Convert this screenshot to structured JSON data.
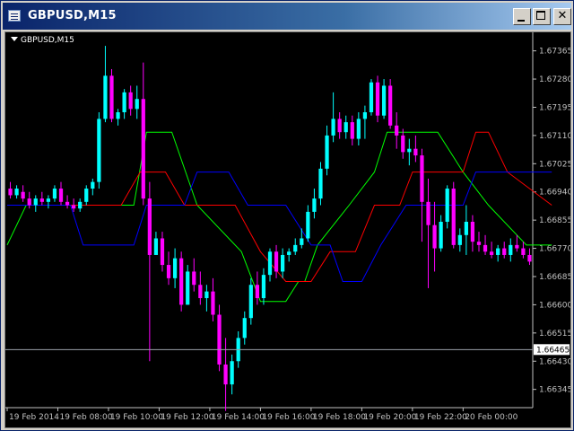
{
  "window": {
    "title": "GBPUSD,M15",
    "buttons": {
      "minimize": "minimize",
      "maximize": "maximize",
      "close": "✕"
    }
  },
  "chart": {
    "symbol_label": "GBPUSD,M15",
    "background": "#000000",
    "bull_color": "#00ffff",
    "bear_color": "#ff00ff",
    "current_price": "1.66465"
  },
  "chart_data": {
    "type": "candlestick",
    "title": "GBPUSD,M15",
    "y_ticks": [
      "1.67365",
      "1.67280",
      "1.67195",
      "1.67110",
      "1.67025",
      "1.66940",
      "1.66855",
      "1.66770",
      "1.66685",
      "1.66600",
      "1.66515",
      "1.66430",
      "1.66345"
    ],
    "ylim": [
      1.6629,
      1.6741
    ],
    "x_ticks": [
      "19 Feb 2014",
      "19 Feb 08:00",
      "19 Feb 10:00",
      "19 Feb 12:00",
      "19 Feb 14:00",
      "19 Feb 16:00",
      "19 Feb 18:00",
      "19 Feb 20:00",
      "19 Feb 22:00",
      "20 Feb 00:00"
    ],
    "current_price_line": 1.66465,
    "candles": [
      [
        1.6695,
        1.6697,
        1.6692,
        1.6693
      ],
      [
        1.6693,
        1.6696,
        1.6692,
        1.6695
      ],
      [
        1.6694,
        1.6696,
        1.6691,
        1.6692
      ],
      [
        1.6692,
        1.6694,
        1.6689,
        1.669
      ],
      [
        1.669,
        1.6693,
        1.6688,
        1.6692
      ],
      [
        1.6692,
        1.6694,
        1.669,
        1.6691
      ],
      [
        1.6691,
        1.6693,
        1.6689,
        1.6692
      ],
      [
        1.6692,
        1.6696,
        1.6691,
        1.6695
      ],
      [
        1.6695,
        1.6697,
        1.669,
        1.6691
      ],
      [
        1.6691,
        1.6693,
        1.6689,
        1.669
      ],
      [
        1.669,
        1.6692,
        1.6688,
        1.6689
      ],
      [
        1.6689,
        1.6692,
        1.6688,
        1.6691
      ],
      [
        1.6691,
        1.6696,
        1.669,
        1.6695
      ],
      [
        1.6695,
        1.6698,
        1.6693,
        1.6697
      ],
      [
        1.6697,
        1.6718,
        1.6695,
        1.6716
      ],
      [
        1.6716,
        1.6738,
        1.6715,
        1.6729
      ],
      [
        1.6729,
        1.6731,
        1.6715,
        1.6716
      ],
      [
        1.6716,
        1.6719,
        1.6714,
        1.6718
      ],
      [
        1.6718,
        1.6725,
        1.6716,
        1.6724
      ],
      [
        1.6724,
        1.6726,
        1.6717,
        1.6719
      ],
      [
        1.6719,
        1.6726,
        1.6716,
        1.6722
      ],
      [
        1.6722,
        1.6733,
        1.669,
        1.6692
      ],
      [
        1.6692,
        1.6697,
        1.6643,
        1.6675
      ],
      [
        1.6675,
        1.6682,
        1.6676,
        1.668
      ],
      [
        1.668,
        1.6682,
        1.667,
        1.6672
      ],
      [
        1.6672,
        1.6676,
        1.6666,
        1.6668
      ],
      [
        1.6668,
        1.6677,
        1.6665,
        1.6674
      ],
      [
        1.6674,
        1.6676,
        1.6658,
        1.666
      ],
      [
        1.666,
        1.6672,
        1.666,
        1.667
      ],
      [
        1.667,
        1.6674,
        1.6664,
        1.6666
      ],
      [
        1.6666,
        1.667,
        1.666,
        1.6662
      ],
      [
        1.6662,
        1.6666,
        1.6658,
        1.6664
      ],
      [
        1.6664,
        1.6668,
        1.6655,
        1.6657
      ],
      [
        1.6657,
        1.666,
        1.664,
        1.6642
      ],
      [
        1.6642,
        1.665,
        1.6628,
        1.6636
      ],
      [
        1.6636,
        1.6645,
        1.6633,
        1.6643
      ],
      [
        1.6643,
        1.6652,
        1.6641,
        1.665
      ],
      [
        1.665,
        1.6658,
        1.6648,
        1.6656
      ],
      [
        1.6656,
        1.6668,
        1.6654,
        1.6666
      ],
      [
        1.6666,
        1.667,
        1.666,
        1.6662
      ],
      [
        1.6662,
        1.6671,
        1.666,
        1.6669
      ],
      [
        1.6669,
        1.6677,
        1.6667,
        1.6676
      ],
      [
        1.6676,
        1.6678,
        1.6668,
        1.667
      ],
      [
        1.667,
        1.6677,
        1.6668,
        1.6675
      ],
      [
        1.6675,
        1.6677,
        1.6673,
        1.6676
      ],
      [
        1.6676,
        1.668,
        1.6675,
        1.6678
      ],
      [
        1.6678,
        1.6683,
        1.6677,
        1.668
      ],
      [
        1.668,
        1.669,
        1.6679,
        1.6688
      ],
      [
        1.6688,
        1.6695,
        1.6686,
        1.6692
      ],
      [
        1.6692,
        1.6703,
        1.669,
        1.6701
      ],
      [
        1.6701,
        1.6714,
        1.6699,
        1.6711
      ],
      [
        1.6711,
        1.6724,
        1.6709,
        1.6716
      ],
      [
        1.6716,
        1.6718,
        1.671,
        1.6712
      ],
      [
        1.6712,
        1.6717,
        1.671,
        1.6715
      ],
      [
        1.6715,
        1.6717,
        1.6708,
        1.671
      ],
      [
        1.671,
        1.6718,
        1.6708,
        1.6716
      ],
      [
        1.6716,
        1.672,
        1.671,
        1.6718
      ],
      [
        1.6718,
        1.6728,
        1.6717,
        1.6727
      ],
      [
        1.6727,
        1.6729,
        1.6715,
        1.6717
      ],
      [
        1.6717,
        1.6728,
        1.6716,
        1.6726
      ],
      [
        1.6726,
        1.6728,
        1.6713,
        1.6714
      ],
      [
        1.6714,
        1.6718,
        1.6707,
        1.6711
      ],
      [
        1.6711,
        1.6713,
        1.6704,
        1.6706
      ],
      [
        1.6706,
        1.671,
        1.6702,
        1.6707
      ],
      [
        1.6707,
        1.6711,
        1.6703,
        1.6705
      ],
      [
        1.6705,
        1.6707,
        1.6679,
        1.6691
      ],
      [
        1.6691,
        1.6698,
        1.6665,
        1.6684
      ],
      [
        1.6684,
        1.6691,
        1.667,
        1.6677
      ],
      [
        1.6677,
        1.6687,
        1.6676,
        1.6685
      ],
      [
        1.6685,
        1.6696,
        1.6683,
        1.6695
      ],
      [
        1.6695,
        1.6697,
        1.6677,
        1.6678
      ],
      [
        1.6678,
        1.6683,
        1.6676,
        1.6681
      ],
      [
        1.6681,
        1.669,
        1.6675,
        1.6685
      ],
      [
        1.6685,
        1.6687,
        1.6676,
        1.6679
      ],
      [
        1.6679,
        1.6682,
        1.6676,
        1.6678
      ],
      [
        1.6678,
        1.6681,
        1.6675,
        1.6676
      ],
      [
        1.6676,
        1.6679,
        1.6674,
        1.6675
      ],
      [
        1.6675,
        1.6678,
        1.6673,
        1.6677
      ],
      [
        1.6677,
        1.6679,
        1.6674,
        1.6675
      ],
      [
        1.6675,
        1.668,
        1.6673,
        1.6678
      ],
      [
        1.6678,
        1.6681,
        1.6676,
        1.6677
      ],
      [
        1.6677,
        1.6679,
        1.6674,
        1.6675
      ],
      [
        1.6675,
        1.6677,
        1.6672,
        1.6673
      ]
    ],
    "series": [
      {
        "name": "",
        "color": "#00ff00",
        "points": [
          [
            0,
            1.6678
          ],
          [
            3,
            1.669
          ],
          [
            20,
            1.669
          ],
          [
            22,
            1.6712
          ],
          [
            26,
            1.6712
          ],
          [
            30,
            1.669
          ],
          [
            37,
            1.6676
          ],
          [
            40,
            1.6661
          ],
          [
            44,
            1.6661
          ],
          [
            46,
            1.6667
          ],
          [
            47,
            1.6667
          ],
          [
            49,
            1.6678
          ],
          [
            54,
            1.669
          ],
          [
            58,
            1.67
          ],
          [
            60,
            1.6712
          ],
          [
            68,
            1.6712
          ],
          [
            72,
            1.67
          ],
          [
            76,
            1.669
          ],
          [
            82,
            1.6678
          ],
          [
            86,
            1.6678
          ]
        ]
      },
      {
        "name": "",
        "color": "#ff0000",
        "points": [
          [
            0,
            1.669
          ],
          [
            18,
            1.669
          ],
          [
            21,
            1.67
          ],
          [
            25,
            1.67
          ],
          [
            28,
            1.669
          ],
          [
            36,
            1.669
          ],
          [
            40,
            1.6676
          ],
          [
            44,
            1.6667
          ],
          [
            48,
            1.6667
          ],
          [
            51,
            1.6676
          ],
          [
            55,
            1.6676
          ],
          [
            58,
            1.669
          ],
          [
            62,
            1.669
          ],
          [
            64,
            1.67
          ],
          [
            72,
            1.67
          ],
          [
            74,
            1.6712
          ],
          [
            76,
            1.6712
          ],
          [
            79,
            1.67
          ],
          [
            86,
            1.669
          ]
        ]
      },
      {
        "name": "",
        "color": "#0000ff",
        "points": [
          [
            0,
            1.669
          ],
          [
            10,
            1.669
          ],
          [
            12,
            1.6678
          ],
          [
            20,
            1.6678
          ],
          [
            22,
            1.669
          ],
          [
            28,
            1.669
          ],
          [
            30,
            1.67
          ],
          [
            35,
            1.67
          ],
          [
            38,
            1.669
          ],
          [
            44,
            1.669
          ],
          [
            48,
            1.6678
          ],
          [
            51,
            1.6678
          ],
          [
            53,
            1.6667
          ],
          [
            56,
            1.6667
          ],
          [
            59,
            1.6678
          ],
          [
            63,
            1.669
          ],
          [
            72,
            1.669
          ],
          [
            74,
            1.67
          ],
          [
            86,
            1.67
          ]
        ]
      }
    ]
  }
}
